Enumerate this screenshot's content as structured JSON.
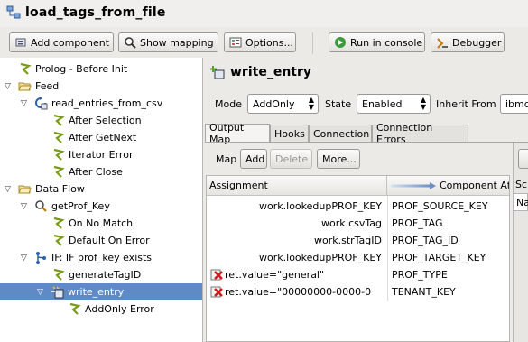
{
  "window": {
    "title": "load_tags_from_file"
  },
  "toolbar": {
    "add_component": "Add component",
    "show_mapping": "Show mapping",
    "options": "Options...",
    "run_console": "Run in console",
    "debugger": "Debugger"
  },
  "tree": {
    "items": [
      {
        "label": "Prolog - Before Init"
      },
      {
        "label": "Feed"
      },
      {
        "label": "read_entries_from_csv"
      },
      {
        "label": "After Selection"
      },
      {
        "label": "After GetNext"
      },
      {
        "label": "Iterator Error"
      },
      {
        "label": "After Close"
      },
      {
        "label": "Data Flow"
      },
      {
        "label": "getProf_Key"
      },
      {
        "label": "On No Match"
      },
      {
        "label": "Default On Error"
      },
      {
        "label": "IF: IF prof_key exists"
      },
      {
        "label": "generateTagID"
      },
      {
        "label": "write_entry"
      },
      {
        "label": "AddOnly Error"
      }
    ]
  },
  "editor": {
    "header": "write_entry",
    "mode_label": "Mode",
    "mode_value": "AddOnly",
    "state_label": "State",
    "state_value": "Enabled",
    "inherit_label": "Inherit From",
    "inherit_value": "ibmc",
    "tabs": [
      "Output Map",
      "Hooks",
      "Connection",
      "Connection Errors"
    ],
    "map_label": "Map",
    "add": "Add",
    "delete": "Delete",
    "more": "More...",
    "col_assignment": "Assignment",
    "col_component": "Component At",
    "side_sc": "Sc",
    "side_na": "Na",
    "rows": [
      {
        "assign": "work.lookedupPROF_KEY",
        "target": "PROF_SOURCE_KEY"
      },
      {
        "assign": "work.csvTag",
        "target": "PROF_TAG"
      },
      {
        "assign": "work.strTagID",
        "target": "PROF_TAG_ID"
      },
      {
        "assign": "work.lookedupPROF_KEY",
        "target": "PROF_TARGET_KEY"
      },
      {
        "assign": "ret.value=\"general\"",
        "target": "PROF_TYPE"
      },
      {
        "assign": "ret.value=\"00000000-0000-0",
        "target": "TENANT_KEY"
      }
    ]
  }
}
